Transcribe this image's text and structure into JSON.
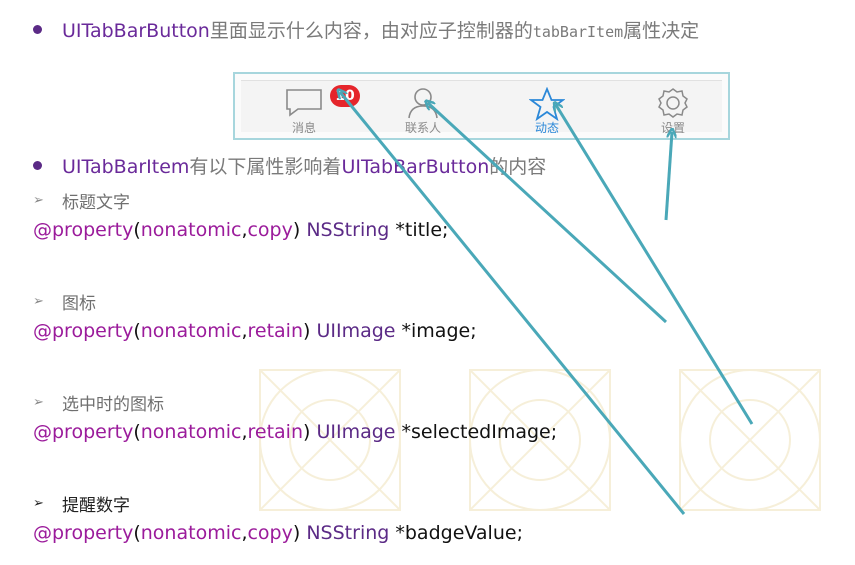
{
  "bullets": {
    "first": {
      "term": "UITabBarButton",
      "text": "里面显示什么内容，由对应子控制器的",
      "mono": "tabBarItem",
      "tail": "属性决定"
    },
    "second": {
      "term1": "UITabBarItem",
      "text1": "有以下属性影响着",
      "term2": "UITabBarButton",
      "text2": "的内容"
    }
  },
  "tabbar": {
    "tabs": [
      {
        "label": "消息",
        "icon": "chat-bubble-icon",
        "badge": "10",
        "selected": false
      },
      {
        "label": "联系人",
        "icon": "person-icon",
        "badge": "",
        "selected": false
      },
      {
        "label": "动态",
        "icon": "star-icon",
        "badge": "",
        "selected": true
      },
      {
        "label": "设置",
        "icon": "gear-icon",
        "badge": "",
        "selected": false
      }
    ]
  },
  "properties": [
    {
      "heading": "标题文字",
      "at": "@property",
      "attrs_open": "(",
      "a1": "nonatomic",
      "comma": ",",
      "a2": "copy",
      "attrs_close": ")",
      "type": "NSString",
      "name": "*title;"
    },
    {
      "heading": "图标",
      "at": "@property",
      "attrs_open": "(",
      "a1": "nonatomic",
      "comma": ",",
      "a2": "retain",
      "attrs_close": ")",
      "type": "UIImage",
      "name": "*image;"
    },
    {
      "heading": "选中时的图标",
      "at": "@property",
      "attrs_open": "(",
      "a1": "nonatomic",
      "comma": ",",
      "a2": "retain",
      "attrs_close": ")",
      "type": "UIImage",
      "name": "*selectedImage;"
    },
    {
      "heading": "提醒数字",
      "at": "@property",
      "attrs_open": "(",
      "a1": "nonatomic",
      "comma": ",",
      "a2": "copy",
      "attrs_close": ")",
      "type": "NSString",
      "name": "*badgeValue;"
    }
  ],
  "colors": {
    "accent_purple": "#6a2a9a",
    "keyword": "#9b1b9b",
    "arrow": "#4aa8b8",
    "selected_tab": "#2b88d8",
    "badge": "#e5252b"
  }
}
